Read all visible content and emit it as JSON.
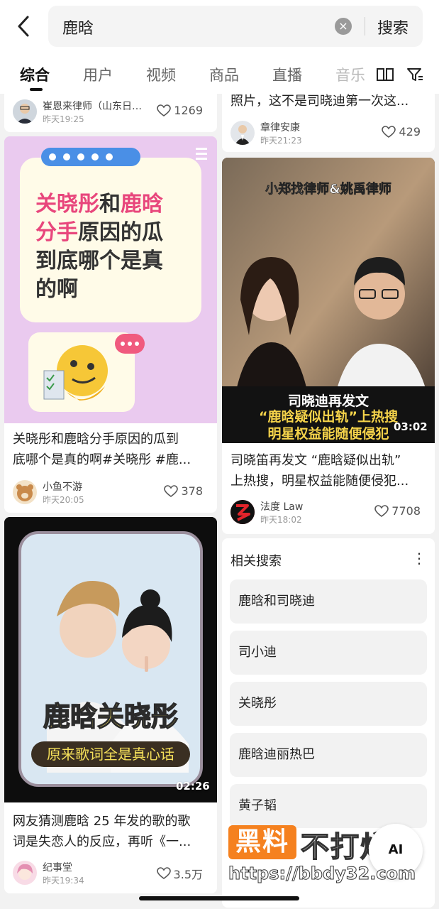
{
  "search": {
    "query": "鹿晗",
    "clear_icon": "close-circle-icon",
    "search_label": "搜索"
  },
  "tabs": [
    {
      "label": "综合",
      "active": true
    },
    {
      "label": "用户"
    },
    {
      "label": "视频"
    },
    {
      "label": "商品"
    },
    {
      "label": "直播"
    },
    {
      "label": "音乐"
    }
  ],
  "left": {
    "card0": {
      "author": "崔恩来律师（山东日…",
      "time": "昨天19:25",
      "likes": "1269"
    },
    "card1": {
      "overlay_line1a": "关晓彤",
      "overlay_line1b": "和",
      "overlay_line1c": "鹿晗",
      "overlay_line2a": "分手",
      "overlay_line2b": "原因的瓜",
      "overlay_line3": "到底哪个是真",
      "overlay_line4": "的啊",
      "title_line1": "关晓彤和鹿晗分手原因的瓜到",
      "title_line2": "底哪个是真的啊#关晓彤 #鹿...",
      "author": "小鱼不游",
      "time": "昨天20:05",
      "likes": "378"
    },
    "card2": {
      "overlay_big": "鹿晗关晓彤",
      "overlay_sub": "原来歌词全是真心话",
      "duration": "02:26",
      "title_line1": "网友猜测鹿晗 25 年发的歌的歌",
      "title_line2": "词是失恋人的反应，再听《一...",
      "author": "纪事堂",
      "time": "昨天19:34",
      "likes": "3.5万"
    }
  },
  "right": {
    "card0": {
      "title_line": "照片，这不是司晓迪第一次这...",
      "author": "章律安康",
      "time": "昨天21:23",
      "likes": "429"
    },
    "card1": {
      "overlay_top": "小郑找律师&姚禹律师",
      "overlay_b1": "司晓迪再发文",
      "overlay_b2": "“鹿晗疑似出轨”上热搜",
      "overlay_b3": "明星权益能随便侵犯",
      "duration": "03:02",
      "title_line1": "司晓笛再发文 “鹿晗疑似出轨”",
      "title_line2": "上热搜，明星权益能随便侵犯...",
      "author": "法度 Law",
      "time": "昨天18:02",
      "likes": "7708"
    }
  },
  "related": {
    "title": "相关搜索",
    "items": [
      "鹿晗和司晓迪",
      "司小迪",
      "关晓彤",
      "鹿晗迪丽热巴",
      "黄子韬"
    ]
  },
  "watermark": {
    "box": "黑料",
    "big": "不打烊",
    "url": "https://bbdy32.com",
    "ai": "AI"
  },
  "colors": {
    "accent_orange": "#f5811f",
    "pink": "#e8467c",
    "yellow_text": "#f5e05a"
  }
}
